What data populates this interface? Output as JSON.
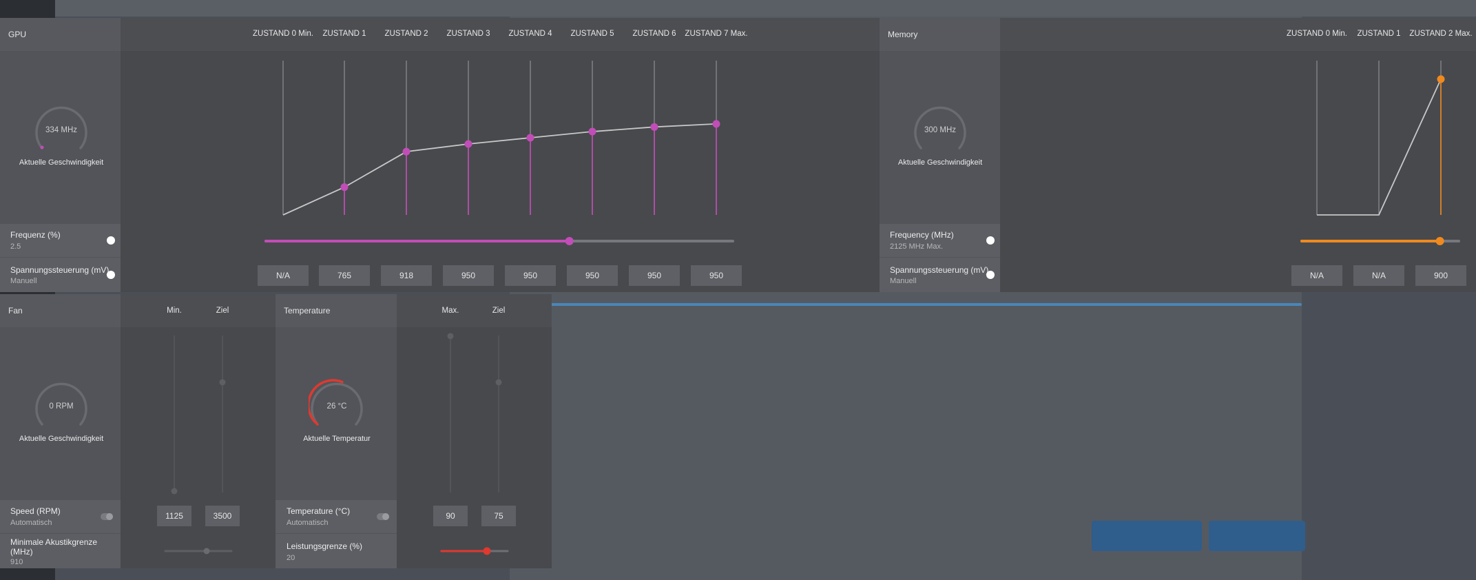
{
  "gpu": {
    "title": "GPU",
    "states": [
      "ZUSTAND 0 Min.",
      "ZUSTAND 1",
      "ZUSTAND 2",
      "ZUSTAND 3",
      "ZUSTAND 4",
      "ZUSTAND 5",
      "ZUSTAND 6",
      "ZUSTAND 7 Max."
    ],
    "gauge_value": "334 MHz",
    "gauge_caption": "Aktuelle Geschwindigkeit",
    "freq_label": "Frequenz (%)",
    "freq_value": "2.5",
    "freq_slider_fraction": 0.65,
    "volt_label": "Spannungssteuerung (mV)",
    "volt_mode": "Manuell",
    "voltages": [
      "N/A",
      "765",
      "918",
      "950",
      "950",
      "950",
      "950",
      "950"
    ],
    "accent": "#c24db8"
  },
  "memory": {
    "title": "Memory",
    "states": [
      "ZUSTAND 0 Min.",
      "ZUSTAND 1",
      "ZUSTAND 2 Max."
    ],
    "gauge_value": "300 MHz",
    "gauge_caption": "Aktuelle Geschwindigkeit",
    "freq_label": "Frequency (MHz)",
    "freq_value": "2125 MHz Max.",
    "freq_slider_fraction": 0.88,
    "volt_label": "Spannungssteuerung (mV)",
    "volt_mode": "Manuell",
    "voltages": [
      "N/A",
      "N/A",
      "900"
    ],
    "accent": "#f08a1e"
  },
  "fan": {
    "title": "Fan",
    "col_min": "Min.",
    "col_target": "Ziel",
    "gauge_value": "0 RPM",
    "gauge_caption": "Aktuelle Geschwindigkeit",
    "speed_label": "Speed (RPM)",
    "speed_mode": "Automatisch",
    "min_value": "1125",
    "target_value": "3500",
    "acoustic_label": "Minimale Akustikgrenze (MHz)",
    "acoustic_value": "910"
  },
  "temperature": {
    "title": "Temperature",
    "col_max": "Max.",
    "col_target": "Ziel",
    "gauge_value": "26 °C",
    "gauge_caption": "Aktuelle Temperatur",
    "temp_label": "Temperature (°C)",
    "temp_mode": "Automatisch",
    "max_value": "90",
    "target_value": "75",
    "power_label": "Leistungsgrenze (%)",
    "power_value": "20",
    "accent": "#e0392f"
  },
  "chart_data": [
    {
      "type": "line",
      "categories": [
        "ZUSTAND 0 Min.",
        "ZUSTAND 1",
        "ZUSTAND 2",
        "ZUSTAND 3",
        "ZUSTAND 4",
        "ZUSTAND 5",
        "ZUSTAND 6",
        "ZUSTAND 7 Max."
      ],
      "values": [
        0,
        18,
        41,
        46,
        50,
        54,
        57,
        59
      ],
      "ylim": [
        0,
        100
      ],
      "grid": "vertical"
    },
    {
      "type": "line",
      "categories": [
        "ZUSTAND 0 Min.",
        "ZUSTAND 1",
        "ZUSTAND 2 Max."
      ],
      "values": [
        0,
        0,
        88
      ],
      "ylim": [
        0,
        100
      ],
      "grid": "vertical"
    }
  ]
}
